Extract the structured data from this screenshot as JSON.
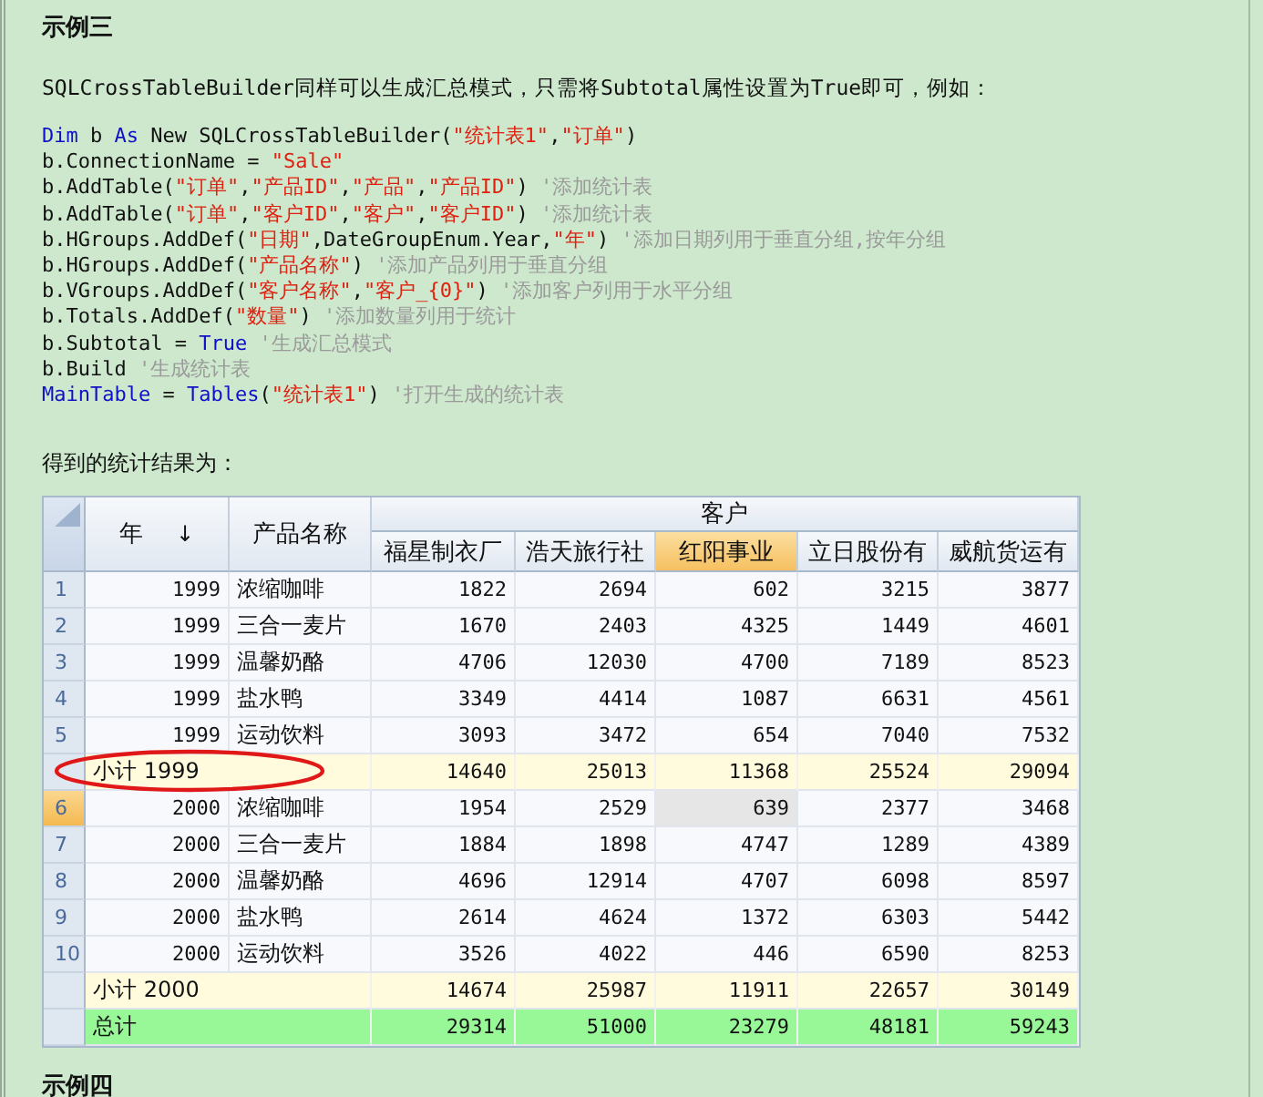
{
  "heading": "示例三",
  "intro": "SQLCrossTableBuilder同样可以生成汇总模式，只需将Subtotal属性设置为True即可，例如：",
  "code": [
    [
      {
        "kind": "keyword",
        "text": "Dim"
      },
      {
        "kind": "plain",
        "text": " b "
      },
      {
        "kind": "keyword",
        "text": "As"
      },
      {
        "kind": "plain",
        "text": " New SQLCrossTableBuilder("
      },
      {
        "kind": "string",
        "text": "\"统计表1\""
      },
      {
        "kind": "plain",
        "text": ","
      },
      {
        "kind": "string",
        "text": "\"订单\""
      },
      {
        "kind": "plain",
        "text": ")"
      }
    ],
    [
      {
        "kind": "plain",
        "text": "b.ConnectionName = "
      },
      {
        "kind": "string",
        "text": "\"Sale\""
      }
    ],
    [
      {
        "kind": "plain",
        "text": "b.AddTable("
      },
      {
        "kind": "string",
        "text": "\"订单\""
      },
      {
        "kind": "plain",
        "text": ","
      },
      {
        "kind": "string",
        "text": "\"产品ID\""
      },
      {
        "kind": "plain",
        "text": ","
      },
      {
        "kind": "string",
        "text": "\"产品\""
      },
      {
        "kind": "plain",
        "text": ","
      },
      {
        "kind": "string",
        "text": "\"产品ID\""
      },
      {
        "kind": "plain",
        "text": ") "
      },
      {
        "kind": "comment",
        "text": "'添加统计表"
      }
    ],
    [
      {
        "kind": "plain",
        "text": "b.AddTable("
      },
      {
        "kind": "string",
        "text": "\"订单\""
      },
      {
        "kind": "plain",
        "text": ","
      },
      {
        "kind": "string",
        "text": "\"客户ID\""
      },
      {
        "kind": "plain",
        "text": ","
      },
      {
        "kind": "string",
        "text": "\"客户\""
      },
      {
        "kind": "plain",
        "text": ","
      },
      {
        "kind": "string",
        "text": "\"客户ID\""
      },
      {
        "kind": "plain",
        "text": ") "
      },
      {
        "kind": "comment",
        "text": "'添加统计表"
      }
    ],
    [
      {
        "kind": "plain",
        "text": "b.HGroups.AddDef("
      },
      {
        "kind": "string",
        "text": "\"日期\""
      },
      {
        "kind": "plain",
        "text": ",DateGroupEnum.Year,"
      },
      {
        "kind": "string",
        "text": "\"年\""
      },
      {
        "kind": "plain",
        "text": ") "
      },
      {
        "kind": "comment",
        "text": "'添加日期列用于垂直分组,按年分组"
      }
    ],
    [
      {
        "kind": "plain",
        "text": "b.HGroups.AddDef("
      },
      {
        "kind": "string",
        "text": "\"产品名称\""
      },
      {
        "kind": "plain",
        "text": ") "
      },
      {
        "kind": "comment",
        "text": "'添加产品列用于垂直分组"
      }
    ],
    [
      {
        "kind": "plain",
        "text": "b.VGroups.AddDef("
      },
      {
        "kind": "string",
        "text": "\"客户名称\""
      },
      {
        "kind": "plain",
        "text": ","
      },
      {
        "kind": "string",
        "text": "\"客户_{0}\""
      },
      {
        "kind": "plain",
        "text": ") "
      },
      {
        "kind": "comment",
        "text": "'添加客户列用于水平分组"
      }
    ],
    [
      {
        "kind": "plain",
        "text": "b.Totals.AddDef("
      },
      {
        "kind": "string",
        "text": "\"数量\""
      },
      {
        "kind": "plain",
        "text": ") "
      },
      {
        "kind": "comment",
        "text": "'添加数量列用于统计"
      }
    ],
    [
      {
        "kind": "plain",
        "text": "b.Subtotal = "
      },
      {
        "kind": "keyword",
        "text": "True"
      },
      {
        "kind": "comment",
        "text": " '生成汇总模式"
      }
    ],
    [
      {
        "kind": "plain",
        "text": "b.Build "
      },
      {
        "kind": "comment",
        "text": "'生成统计表"
      }
    ],
    [
      {
        "kind": "keyword",
        "text": "MainTable"
      },
      {
        "kind": "plain",
        "text": " = "
      },
      {
        "kind": "keyword",
        "text": "Tables"
      },
      {
        "kind": "plain",
        "text": "("
      },
      {
        "kind": "string",
        "text": "\"统计表1\""
      },
      {
        "kind": "plain",
        "text": ") "
      },
      {
        "kind": "comment",
        "text": "'打开生成的统计表"
      }
    ]
  ],
  "result_label": "得到的统计结果为：",
  "table": {
    "group_header": "客户",
    "row_columns": [
      {
        "label": "年",
        "sort": "↓"
      },
      {
        "label": "产品名称"
      }
    ],
    "columns": [
      {
        "label": "福星制衣厂",
        "selected": false
      },
      {
        "label": "浩天旅行社",
        "selected": false
      },
      {
        "label": "红阳事业",
        "selected": true
      },
      {
        "label": "立日股份有",
        "selected": false
      },
      {
        "label": "威航货运有",
        "selected": false
      }
    ],
    "rows": [
      {
        "kind": "data",
        "number": "1",
        "year": "1999",
        "product": "浓缩咖啡",
        "values": [
          "1822",
          "2694",
          "602",
          "3215",
          "3877"
        ],
        "selected": false
      },
      {
        "kind": "data",
        "number": "2",
        "year": "1999",
        "product": "三合一麦片",
        "values": [
          "1670",
          "2403",
          "4325",
          "1449",
          "4601"
        ],
        "selected": false
      },
      {
        "kind": "data",
        "number": "3",
        "year": "1999",
        "product": "温馨奶酪",
        "values": [
          "4706",
          "12030",
          "4700",
          "7189",
          "8523"
        ],
        "selected": false
      },
      {
        "kind": "data",
        "number": "4",
        "year": "1999",
        "product": "盐水鸭",
        "values": [
          "3349",
          "4414",
          "1087",
          "6631",
          "4561"
        ],
        "selected": false
      },
      {
        "kind": "data",
        "number": "5",
        "year": "1999",
        "product": "运动饮料",
        "values": [
          "3093",
          "3472",
          "654",
          "7040",
          "7532"
        ],
        "selected": false
      },
      {
        "kind": "subtotal",
        "label": "小计  1999",
        "values": [
          "14640",
          "25013",
          "11368",
          "25524",
          "29094"
        ],
        "selected": false
      },
      {
        "kind": "data",
        "number": "6",
        "year": "2000",
        "product": "浓缩咖啡",
        "values": [
          "1954",
          "2529",
          "639",
          "2377",
          "3468"
        ],
        "selected": true
      },
      {
        "kind": "data",
        "number": "7",
        "year": "2000",
        "product": "三合一麦片",
        "values": [
          "1884",
          "1898",
          "4747",
          "1289",
          "4389"
        ],
        "selected": false
      },
      {
        "kind": "data",
        "number": "8",
        "year": "2000",
        "product": "温馨奶酪",
        "values": [
          "4696",
          "12914",
          "4707",
          "6098",
          "8597"
        ],
        "selected": false
      },
      {
        "kind": "data",
        "number": "9",
        "year": "2000",
        "product": "盐水鸭",
        "values": [
          "2614",
          "4624",
          "1372",
          "6303",
          "5442"
        ],
        "selected": false
      },
      {
        "kind": "data",
        "number": "10",
        "year": "2000",
        "product": "运动饮料",
        "values": [
          "3526",
          "4022",
          "446",
          "6590",
          "8253"
        ],
        "selected": false
      },
      {
        "kind": "subtotal",
        "label": "小计  2000",
        "values": [
          "14674",
          "25987",
          "11911",
          "22657",
          "30149"
        ],
        "selected": false
      },
      {
        "kind": "total",
        "label": "总计",
        "values": [
          "29314",
          "51000",
          "23279",
          "48181",
          "59243"
        ],
        "selected": false
      }
    ]
  },
  "next_heading": "示例四"
}
